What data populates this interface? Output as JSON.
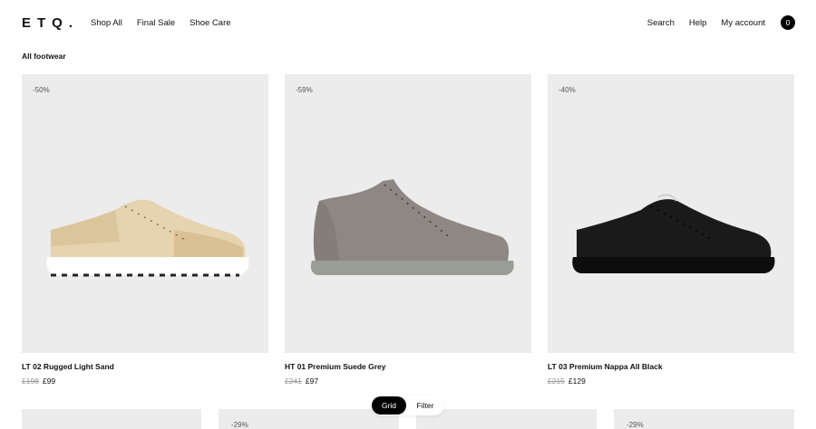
{
  "header": {
    "logo": "ETQ.",
    "nav_left": [
      "Shop All",
      "Final Sale",
      "Shoe Care"
    ],
    "nav_right": [
      "Search",
      "Help",
      "My account"
    ],
    "cart_count": "0"
  },
  "page_title": "All footwear",
  "products": [
    {
      "discount": "-50%",
      "name": "LT 02 Rugged Light Sand",
      "old_price": "£198",
      "new_price": "£99",
      "color": "light-sand",
      "icon": "sneaker-low-icon"
    },
    {
      "discount": "-59%",
      "name": "HT 01 Premium Suede Grey",
      "old_price": "£241",
      "new_price": "£97",
      "color": "grey",
      "icon": "sneaker-high-icon"
    },
    {
      "discount": "-40%",
      "name": "LT 03 Premium Nappa All Black",
      "old_price": "£215",
      "new_price": "£129",
      "color": "black",
      "icon": "sneaker-low-icon"
    }
  ],
  "row2_discounts": [
    "",
    "-29%",
    "",
    "-29%"
  ],
  "view_toggle": {
    "grid_label": "Grid",
    "filter_label": "Filter",
    "selected": "Grid"
  },
  "colors": {
    "accent": "#000000",
    "tile_background": "#ececec"
  }
}
